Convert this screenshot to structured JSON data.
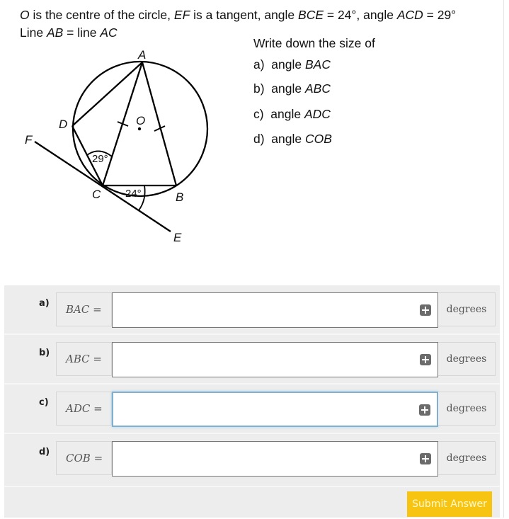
{
  "problem": {
    "line1": {
      "segments": [
        {
          "text": "O",
          "italic": true
        },
        {
          "text": " is the centre of the circle, ",
          "italic": false
        },
        {
          "text": "EF",
          "italic": true
        },
        {
          "text": " is a tangent, angle ",
          "italic": false
        },
        {
          "text": "BCE",
          "italic": true
        },
        {
          "text": " = 24°, angle ",
          "italic": false
        },
        {
          "text": "ACD",
          "italic": true
        },
        {
          "text": " = 29°",
          "italic": false
        }
      ]
    },
    "line2": {
      "segments": [
        {
          "text": "Line ",
          "italic": false
        },
        {
          "text": "AB",
          "italic": true
        },
        {
          "text": " = line ",
          "italic": false
        },
        {
          "text": "AC",
          "italic": true
        }
      ]
    }
  },
  "diagram": {
    "points": {
      "A": "A",
      "B": "B",
      "C": "C",
      "D": "D",
      "E": "E",
      "F": "F",
      "O": "O"
    },
    "angle_acd": "29°",
    "angle_bce": "24°"
  },
  "tasks": {
    "heading": "Write down the size of",
    "items": [
      {
        "prefix": "a)",
        "word": "angle",
        "name": "BAC"
      },
      {
        "prefix": "b)",
        "word": "angle",
        "name": "ABC"
      },
      {
        "prefix": "c)",
        "word": "angle",
        "name": "ADC"
      },
      {
        "prefix": "d)",
        "word": "angle",
        "name": "COB"
      }
    ]
  },
  "answers": {
    "rows": [
      {
        "label": "a)",
        "prefix": "BAC =",
        "value": "",
        "suffix": "degrees",
        "focused": false
      },
      {
        "label": "b)",
        "prefix": "ABC =",
        "value": "",
        "suffix": "degrees",
        "focused": false
      },
      {
        "label": "c)",
        "prefix": "ADC =",
        "value": "",
        "suffix": "degrees",
        "focused": true
      },
      {
        "label": "d)",
        "prefix": "COB =",
        "value": "",
        "suffix": "degrees",
        "focused": false
      }
    ],
    "submit_label": "Submit Answer"
  }
}
